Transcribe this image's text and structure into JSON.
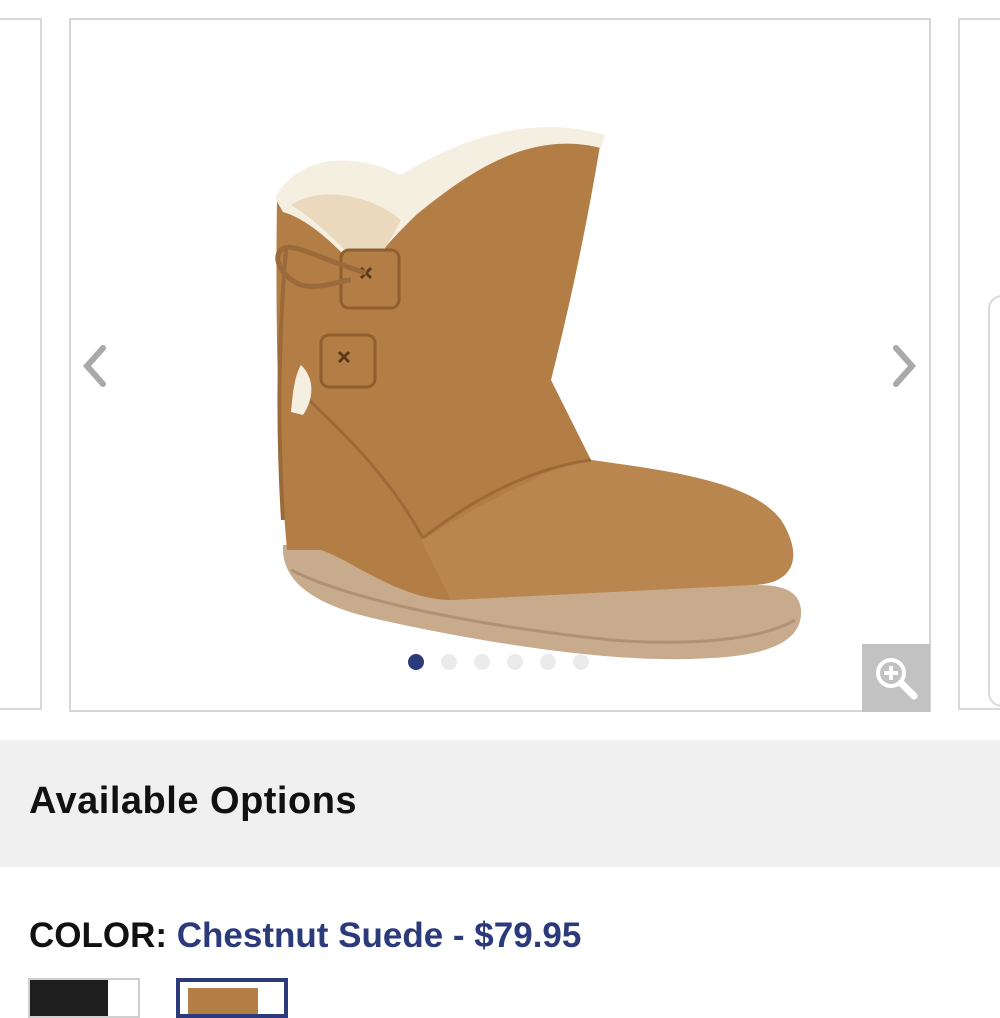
{
  "options": {
    "title": "Available Options",
    "color_label": "COLOR:",
    "color_value": "Chestnut Suede - $79.95"
  },
  "carousel": {
    "dot_count": 6,
    "active_index": 0
  },
  "icons": [
    "chevron-left-icon",
    "chevron-right-icon",
    "zoom-in-icon"
  ],
  "colors": {
    "accent": "#2b3a7a",
    "band": "#f0f0f0",
    "boot": "#b37e45"
  }
}
